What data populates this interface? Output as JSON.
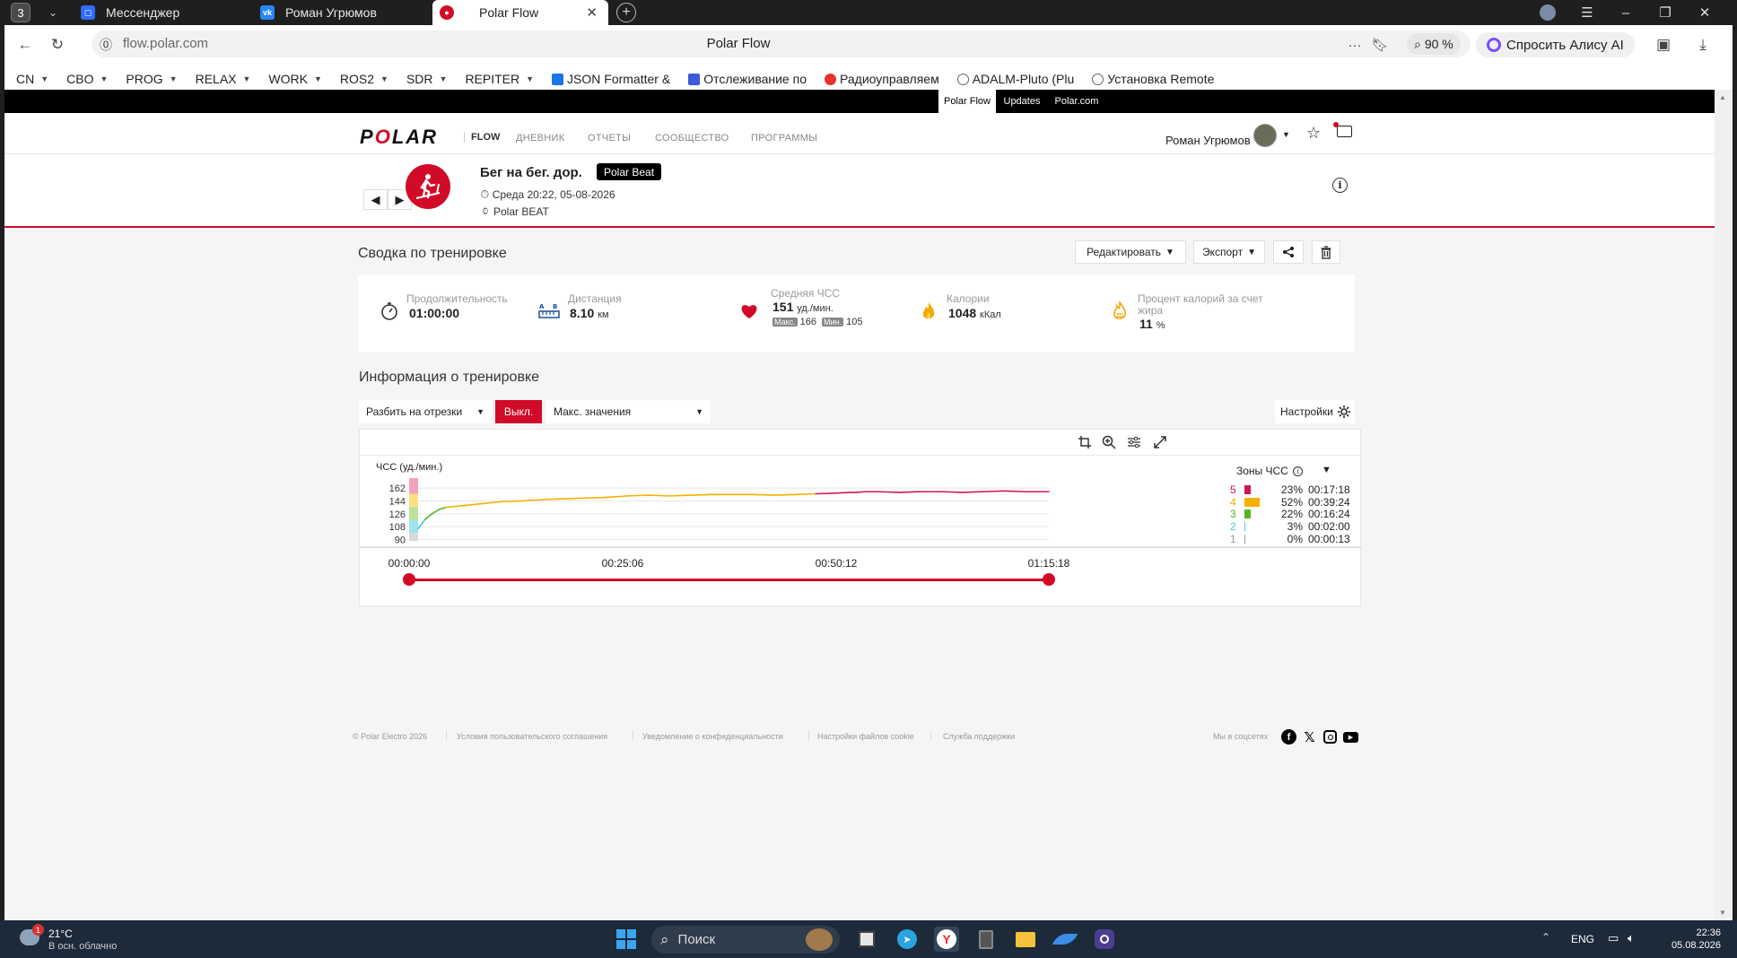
{
  "browser": {
    "tab_count": "3",
    "tabs": [
      {
        "label": "Мессенджер"
      },
      {
        "label": "Роман Угрюмов"
      },
      {
        "label": "Polar Flow"
      }
    ],
    "url": "flow.polar.com",
    "page_title": "Polar Flow",
    "zoom": "90 %",
    "alice_label": "Спросить Алису AI",
    "bookmarks": [
      {
        "label": "CN"
      },
      {
        "label": "CBO"
      },
      {
        "label": "PROG"
      },
      {
        "label": "RELAX"
      },
      {
        "label": "WORK"
      },
      {
        "label": "ROS2"
      },
      {
        "label": "SDR"
      },
      {
        "label": "REPITER"
      },
      {
        "label": "JSON Formatter &"
      },
      {
        "label": "Отслеживание по"
      },
      {
        "label": "Радиоуправляем"
      },
      {
        "label": "ADALM-Pluto (Plu"
      },
      {
        "label": "Установка Remote"
      }
    ]
  },
  "site": {
    "top_links": [
      "Polar Flow",
      "Updates",
      "Polar.com"
    ],
    "logo": "POLAR",
    "flow_tag": "FLOW",
    "nav": [
      "ДНЕВНИК",
      "ОТЧЕТЫ",
      "СООБЩЕСТВО",
      "ПРОГРАММЫ"
    ],
    "user_name": "Роман Угрюмов"
  },
  "activity": {
    "title": "Бег на бег. дор.",
    "badge": "Polar Beat",
    "date": "Среда 20:22, 05-08-2026",
    "device": "Polar BEAT"
  },
  "summary": {
    "title": "Сводка по тренировке",
    "edit_label": "Редактировать",
    "export_label": "Экспорт",
    "duration_label": "Продолжительность",
    "duration_value": "01:00:00",
    "distance_label": "Дистанция",
    "distance_value": "8.10",
    "distance_unit": "км",
    "hr_label": "Средняя ЧСС",
    "hr_value": "151",
    "hr_unit": "уд./мин.",
    "hr_max_tag": "Макс.",
    "hr_max": "166",
    "hr_min_tag": "Мин.",
    "hr_min": "105",
    "cal_label": "Калории",
    "cal_value": "1048",
    "cal_unit": "кКал",
    "fat_label_1": "Процент калорий за счет",
    "fat_label_2": "жира",
    "fat_value": "11",
    "fat_unit": "%"
  },
  "info": {
    "title": "Информация о тренировке",
    "split_label": "Разбить на отрезки",
    "off_label": "Выкл.",
    "max_label": "Макс. значения",
    "settings_label": "Настройки",
    "ylabel": "ЧСС (уд./мин.)",
    "zones_title": "Зоны ЧСС",
    "zones": [
      {
        "zone": "5",
        "pct": "23%",
        "time": "00:17:18",
        "color": "#d1155a",
        "frac": 0.23
      },
      {
        "zone": "4",
        "pct": "52%",
        "time": "00:39:24",
        "color": "#f5b100",
        "frac": 0.52
      },
      {
        "zone": "3",
        "pct": "22%",
        "time": "00:16:24",
        "color": "#55b520",
        "frac": 0.22
      },
      {
        "zone": "2",
        "pct": "3%",
        "time": "00:02:00",
        "color": "#48c6e6",
        "frac": 0.03
      },
      {
        "zone": "1",
        "pct": "0%",
        "time": "00:00:13",
        "color": "#9a9a9a",
        "frac": 0.0
      }
    ],
    "time_labels": [
      "00:00:00",
      "00:25:06",
      "00:50:12",
      "01:15:18"
    ]
  },
  "chart_data": {
    "type": "line",
    "title": "",
    "xlabel": "",
    "ylabel": "ЧСС (уд./мин.)",
    "yticks": [
      90,
      108,
      126,
      144,
      162
    ],
    "ylim": [
      88,
      176
    ],
    "xlim": [
      0,
      90.4
    ],
    "x_unit": "min",
    "zone_bands": [
      {
        "zone": "1",
        "from": 88,
        "to": 99,
        "color": "#d9d9d9"
      },
      {
        "zone": "2",
        "from": 99,
        "to": 117,
        "color": "#9ee3f2"
      },
      {
        "zone": "3",
        "from": 117,
        "to": 136,
        "color": "#bde39a"
      },
      {
        "zone": "4",
        "from": 136,
        "to": 154,
        "color": "#fbe27f"
      },
      {
        "zone": "5",
        "from": 154,
        "to": 176,
        "color": "#f3a2bd"
      }
    ],
    "zone_colors": [
      "#9a9a9a",
      "#48c6e6",
      "#55b520",
      "#f5b100",
      "#d1155a"
    ],
    "zone_limits": [
      99,
      117,
      136,
      154
    ],
    "series": [
      {
        "x": [
          0,
          1,
          2,
          3,
          4,
          6,
          8,
          10,
          12,
          15,
          18,
          21,
          24,
          27,
          30,
          33,
          36,
          39,
          42,
          45,
          48,
          51,
          54,
          57,
          60,
          62,
          63,
          64,
          66,
          69,
          72,
          75,
          78,
          81,
          84,
          87,
          88.5,
          90.4
        ],
        "values": [
          105,
          118,
          126,
          132,
          135,
          137,
          139,
          141,
          143,
          144,
          146,
          147,
          148,
          149,
          151,
          152,
          151,
          152,
          153,
          153,
          153,
          152,
          153,
          154,
          155,
          156,
          156,
          157,
          157,
          156,
          157,
          157,
          156,
          157,
          158,
          157,
          157,
          157
        ]
      }
    ]
  },
  "footer": {
    "copyright": "© Polar Electro 2026",
    "links": [
      "Условия пользовательского соглашения",
      "Уведомление о конфиденциальности",
      "Настройки файлов cookie",
      "Служба поддержки"
    ],
    "social_label": "Мы в соцсетях"
  },
  "taskbar": {
    "temp": "21°C",
    "weather": "В осн. облачно",
    "weather_badge": "1",
    "search": "Поиск",
    "lang": "ENG",
    "time": "22:36",
    "date": "05.08.2026"
  }
}
